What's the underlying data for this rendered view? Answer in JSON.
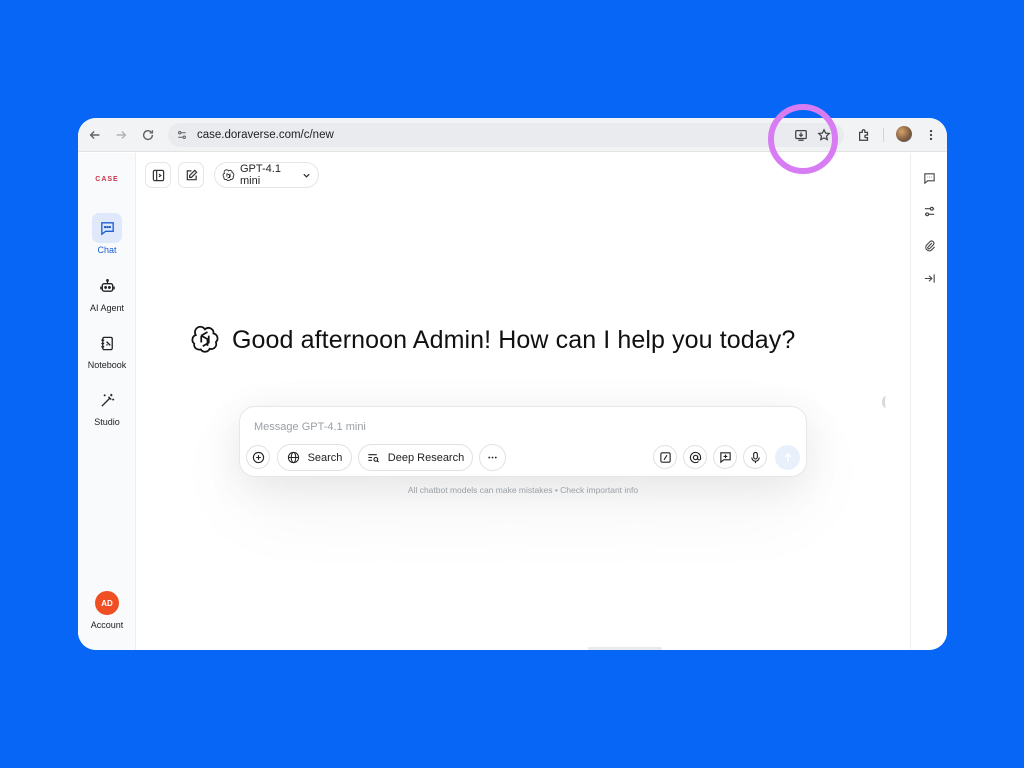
{
  "browser": {
    "url": "case.doraverse.com/c/new"
  },
  "sidebar": {
    "logo": "CASE",
    "items": [
      {
        "label": "Chat",
        "icon": "chat-icon",
        "active": true
      },
      {
        "label": "AI Agent",
        "icon": "robot-icon",
        "active": false
      },
      {
        "label": "Notebook",
        "icon": "notebook-icon",
        "active": false
      },
      {
        "label": "Studio",
        "icon": "magic-wand-icon",
        "active": false
      }
    ],
    "account": {
      "initials": "AD",
      "label": "Account"
    }
  },
  "topbar": {
    "model": "GPT-4.1 mini"
  },
  "main": {
    "greeting": "Good afternoon Admin! How can I help you today?"
  },
  "composer": {
    "placeholder": "Message GPT-4.1 mini",
    "search_label": "Search",
    "deep_research_label": "Deep Research",
    "disclaimer": "All chatbot models can make mistakes • Check important info"
  },
  "colors": {
    "background": "#0866f6",
    "accent": "#1a5fd1",
    "highlight_ring": "#d77cf2",
    "avatar": "#f04f24"
  }
}
